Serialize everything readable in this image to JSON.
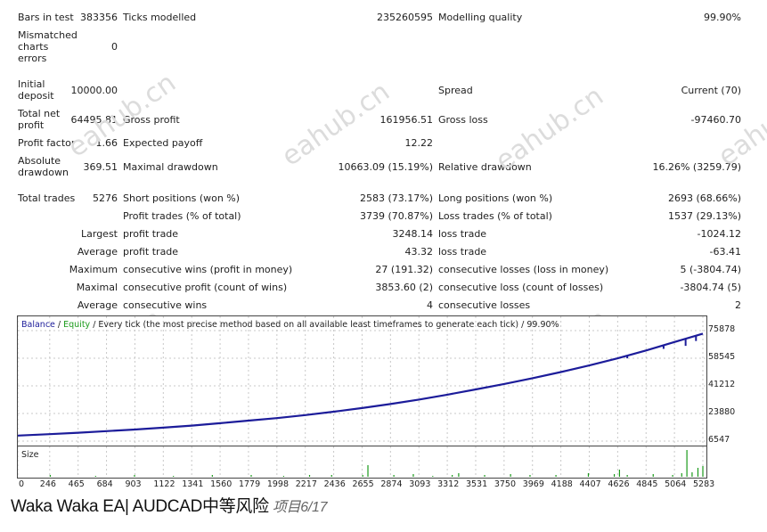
{
  "stats": {
    "bars_in_test_label": "Bars in test",
    "bars_in_test": "383356",
    "ticks_modelled_label": "Ticks modelled",
    "ticks_modelled": "235260595",
    "modelling_quality_label": "Modelling quality",
    "modelling_quality": "99.90%",
    "mismatched_label": "Mismatched charts errors",
    "mismatched": "0",
    "initial_deposit_label": "Initial deposit",
    "initial_deposit": "10000.00",
    "spread_label": "Spread",
    "spread": "Current (70)",
    "total_net_profit_label": "Total net profit",
    "total_net_profit": "64495.81",
    "gross_profit_label": "Gross profit",
    "gross_profit": "161956.51",
    "gross_loss_label": "Gross loss",
    "gross_loss": "-97460.70",
    "profit_factor_label": "Profit factor",
    "profit_factor": "1.66",
    "expected_payoff_label": "Expected payoff",
    "expected_payoff": "12.22",
    "absolute_drawdown_label": "Absolute drawdown",
    "absolute_drawdown": "369.51",
    "maximal_drawdown_label": "Maximal drawdown",
    "maximal_drawdown": "10663.09 (15.19%)",
    "relative_drawdown_label": "Relative drawdown",
    "relative_drawdown": "16.26% (3259.79)",
    "total_trades_label": "Total trades",
    "total_trades": "5276",
    "short_positions_label": "Short positions (won %)",
    "short_positions": "2583 (73.17%)",
    "long_positions_label": "Long positions (won %)",
    "long_positions": "2693 (68.66%)",
    "profit_trades_label": "Profit trades (% of total)",
    "profit_trades": "3739 (70.87%)",
    "loss_trades_label": "Loss trades (% of total)",
    "loss_trades": "1537 (29.13%)",
    "largest_label": "Largest",
    "largest_profit_label": "profit trade",
    "largest_profit": "3248.14",
    "largest_loss_label": "loss trade",
    "largest_loss": "-1024.12",
    "average_label": "Average",
    "average_profit_label": "profit trade",
    "average_profit": "43.32",
    "average_loss_label": "loss trade",
    "average_loss": "-63.41",
    "maximum_label": "Maximum",
    "max_cons_wins_label": "consecutive wins (profit in money)",
    "max_cons_wins": "27 (191.32)",
    "max_cons_losses_label": "consecutive losses (loss in money)",
    "max_cons_losses": "5 (-3804.74)",
    "maximal_label": "Maximal",
    "maximal_cons_profit_label": "consecutive profit (count of wins)",
    "maximal_cons_profit": "3853.60 (2)",
    "maximal_cons_loss_label": "consecutive loss (count of losses)",
    "maximal_cons_loss": "-3804.74 (5)",
    "average2_label": "Average",
    "avg_cons_wins_label": "consecutive wins",
    "avg_cons_wins": "4",
    "avg_cons_losses_label": "consecutive losses",
    "avg_cons_losses": "2"
  },
  "chart_legend": {
    "balance": "Balance",
    "sep1": " / ",
    "equity": "Equity",
    "rest": " / Every tick (the most precise method based on all available least timeframes to generate each tick) / 99.90%"
  },
  "size_label": "Size",
  "watermark": "eahub.cn",
  "footer": {
    "title": "Waka Waka EA| AUDCAD中等风险",
    "sub": "项目6/17"
  },
  "colors": {
    "balance": "#1c1c9a",
    "equity": "#1a9a1a",
    "grid": "#c8c8c8",
    "size_bars": "#1a9a1a"
  },
  "chart_data": {
    "type": "line",
    "x": [
      0,
      246,
      465,
      684,
      903,
      1122,
      1341,
      1560,
      1779,
      1998,
      2217,
      2436,
      2655,
      2874,
      3093,
      3312,
      3531,
      3750,
      3969,
      4188,
      4407,
      4626,
      4845,
      5064,
      5283
    ],
    "series": [
      {
        "name": "Balance",
        "values": [
          10000,
          10900,
          11800,
          12800,
          13800,
          15000,
          16300,
          17800,
          19400,
          21000,
          22900,
          25000,
          27300,
          29800,
          32600,
          35700,
          39000,
          42400,
          46000,
          49900,
          54000,
          58500,
          63400,
          68700,
          74000
        ]
      }
    ],
    "yticks": [
      "75878",
      "58545",
      "41212",
      "23880",
      "6547"
    ],
    "xticks": [
      "0",
      "246",
      "465",
      "684",
      "903",
      "1122",
      "1341",
      "1560",
      "1779",
      "1998",
      "2217",
      "2436",
      "2655",
      "2874",
      "3093",
      "3312",
      "3531",
      "3750",
      "3969",
      "4188",
      "4407",
      "4626",
      "4845",
      "5064",
      "5283"
    ],
    "ylim": [
      6547,
      75878
    ],
    "grid": true
  }
}
